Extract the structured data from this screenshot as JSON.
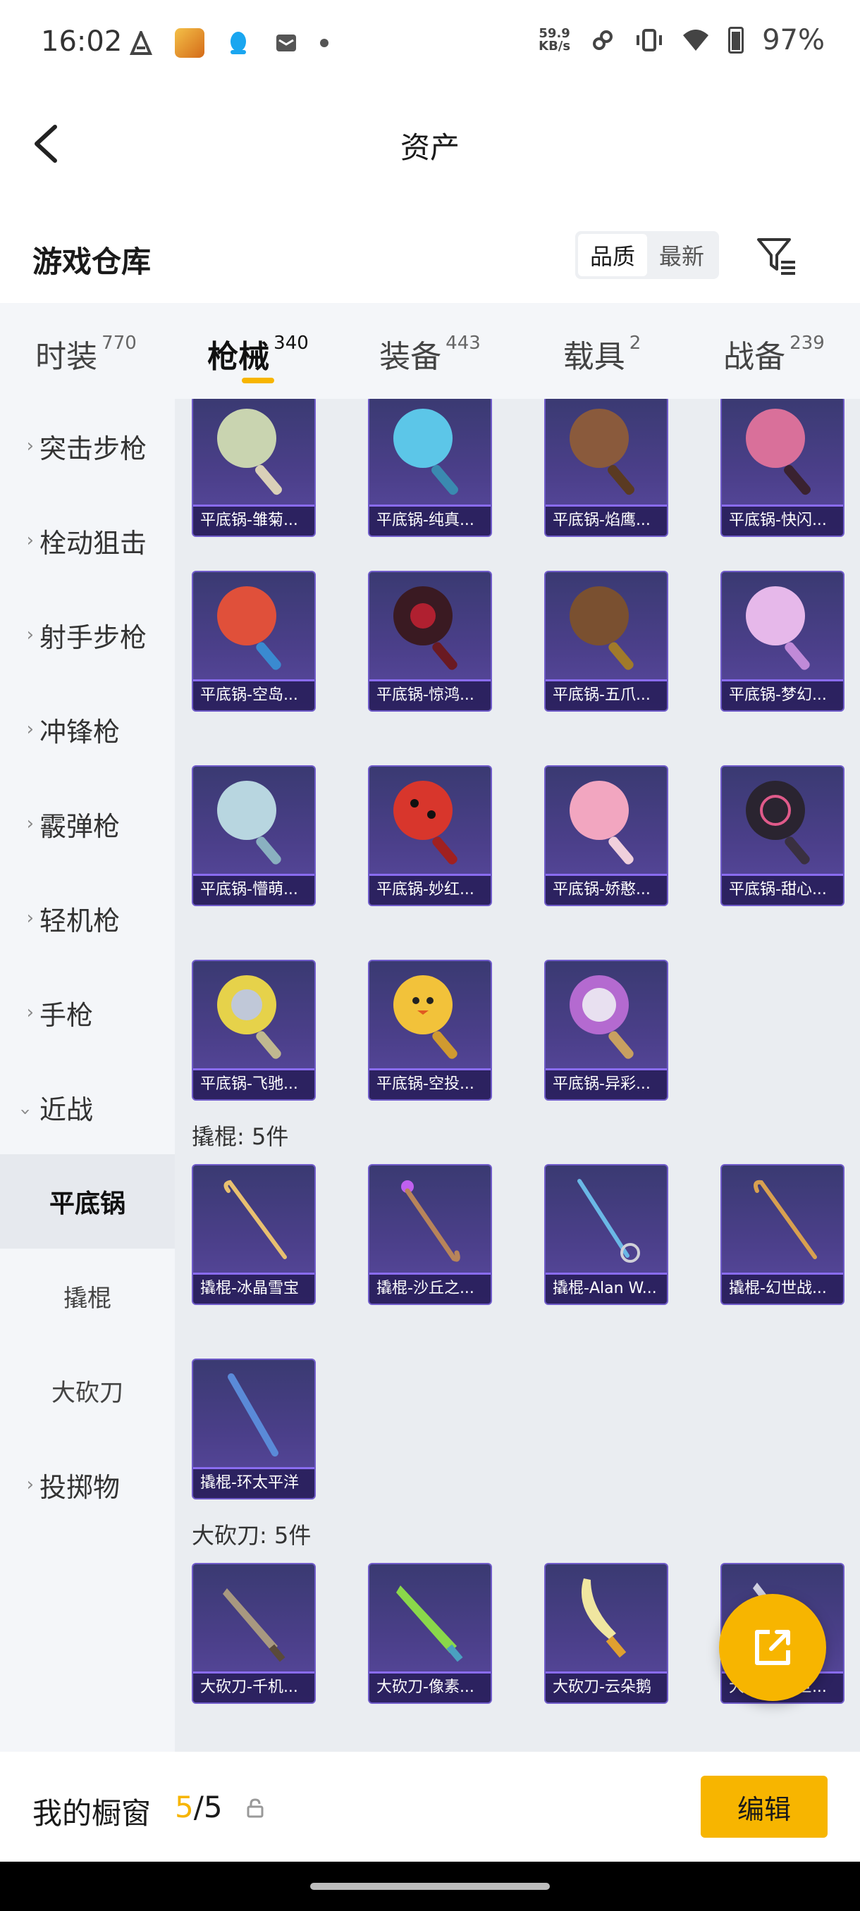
{
  "status_bar": {
    "time": "16:02",
    "net_speed_value": "59.9",
    "net_speed_unit": "KB/s",
    "battery": "97%"
  },
  "header": {
    "title": "资产"
  },
  "warehouse": {
    "title": "游戏仓库",
    "sort_quality": "品质",
    "sort_newest": "最新"
  },
  "tabs": [
    {
      "label": "时装",
      "count": "770"
    },
    {
      "label": "枪械",
      "count": "340",
      "active": true
    },
    {
      "label": "装备",
      "count": "443"
    },
    {
      "label": "载具",
      "count": "2"
    },
    {
      "label": "战备",
      "count": "239"
    }
  ],
  "sidebar": {
    "items": [
      {
        "label": "突击步枪"
      },
      {
        "label": "栓动狙击"
      },
      {
        "label": "射手步枪"
      },
      {
        "label": "冲锋枪"
      },
      {
        "label": "霰弹枪"
      },
      {
        "label": "轻机枪"
      },
      {
        "label": "手枪"
      },
      {
        "label": "近战",
        "expanded": true
      }
    ],
    "subitems": [
      {
        "label": "平底锅",
        "active": true
      },
      {
        "label": "撬棍"
      },
      {
        "label": "大砍刀"
      }
    ],
    "last_item": {
      "label": "投掷物"
    }
  },
  "sections": {
    "pans": [
      {
        "name": "平底锅-雏菊...",
        "color": "#c9d4b0"
      },
      {
        "name": "平底锅-纯真...",
        "color": "#5cc6e8"
      },
      {
        "name": "平底锅-焰鹰...",
        "color": "#8a5a3c"
      },
      {
        "name": "平底锅-快闪...",
        "color": "#d9709a"
      },
      {
        "name": "平底锅-空岛...",
        "color": "#e0503a"
      },
      {
        "name": "平底锅-惊鸿...",
        "color": "#3a1a22"
      },
      {
        "name": "平底锅-五爪...",
        "color": "#7a5030"
      },
      {
        "name": "平底锅-梦幻...",
        "color": "#e6b8ea"
      },
      {
        "name": "平底锅-懵萌...",
        "color": "#b8d6e0"
      },
      {
        "name": "平底锅-妙红...",
        "color": "#d8362c"
      },
      {
        "name": "平底锅-娇憨...",
        "color": "#f2a6c0"
      },
      {
        "name": "平底锅-甜心...",
        "color": "#2a2430"
      },
      {
        "name": "平底锅-飞驰...",
        "color": "#e6d24a"
      },
      {
        "name": "平底锅-空投...",
        "color": "#f2c23a"
      },
      {
        "name": "平底锅-异彩...",
        "color": "#b46ad0"
      }
    ],
    "crowbar_label": "撬棍: 5件",
    "crowbars": [
      {
        "name": "撬棍-冰晶雪宝",
        "color": "#e8c070"
      },
      {
        "name": "撬棍-沙丘之...",
        "color": "#b8845a"
      },
      {
        "name": "撬棍-Alan W...",
        "color": "#6ab8e6"
      },
      {
        "name": "撬棍-幻世战...",
        "color": "#d8a050"
      },
      {
        "name": "撬棍-环太平洋",
        "color": "#5a8ad8"
      }
    ],
    "machete_label": "大砍刀: 5件",
    "machetes": [
      {
        "name": "大砍刀-千机...",
        "color": "#a89880"
      },
      {
        "name": "大砍刀-像素...",
        "color": "#8ad84a"
      },
      {
        "name": "大砍刀-云朵鹅",
        "color": "#f0e6a0"
      },
      {
        "name": "大砍刀-幻世...",
        "color": "#d0d0e0"
      }
    ]
  },
  "showcase": {
    "label": "我的橱窗",
    "current": "5",
    "total": "/5",
    "edit": "编辑"
  },
  "colors": {
    "accent": "#f7b500",
    "card_bg": "#4b3f8a"
  }
}
